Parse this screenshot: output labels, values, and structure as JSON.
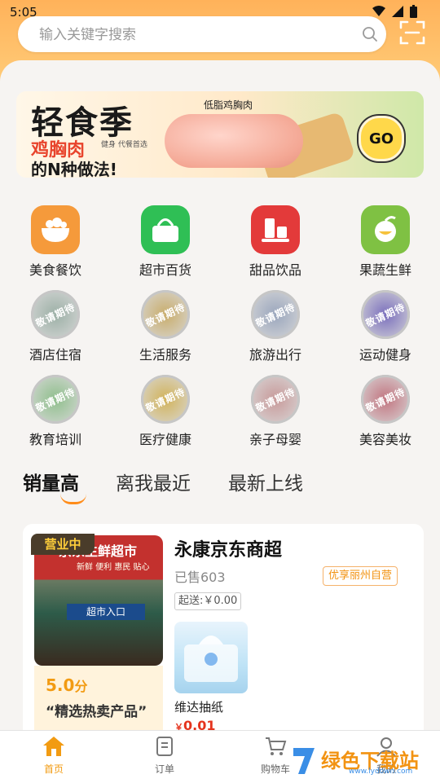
{
  "status_bar": {
    "time": "5:05"
  },
  "search": {
    "placeholder": "输入关键字搜索"
  },
  "banner": {
    "title": "轻食季",
    "line1": "鸡胸肉",
    "line2": "的N种做法!",
    "tag": "健身 代餐首选",
    "label": "低脂鸡胸肉",
    "go": "GO"
  },
  "categories": [
    {
      "label": "美食餐饮",
      "icon": "food-bowl-icon",
      "color": "#f59a3b"
    },
    {
      "label": "超市百货",
      "icon": "shopping-basket-icon",
      "color": "#2fbf55"
    },
    {
      "label": "甜品饮品",
      "icon": "dessert-drink-icon",
      "color": "#e33a3a"
    },
    {
      "label": "果蔬生鲜",
      "icon": "fruit-icon",
      "color": "#7fc143"
    },
    {
      "label": "酒店住宿",
      "icon": "coming-soon-icon",
      "color": "#9cb0a6"
    },
    {
      "label": "生活服务",
      "icon": "coming-soon-icon",
      "color": "#c9ad6b"
    },
    {
      "label": "旅游出行",
      "icon": "coming-soon-icon",
      "color": "#9aa6bd"
    },
    {
      "label": "运动健身",
      "icon": "coming-soon-icon",
      "color": "#7a6fbd"
    },
    {
      "label": "教育培训",
      "icon": "coming-soon-icon",
      "color": "#8fbf8c"
    },
    {
      "label": "医疗健康",
      "icon": "coming-soon-icon",
      "color": "#d2b35a"
    },
    {
      "label": "亲子母婴",
      "icon": "coming-soon-icon",
      "color": "#c89a9a"
    },
    {
      "label": "美容美妆",
      "icon": "coming-soon-icon",
      "color": "#c27580"
    }
  ],
  "coming_soon_text": "敬请期待",
  "tabs": [
    "销量高",
    "离我最近",
    "最新上线"
  ],
  "shop": {
    "badge": "营业中",
    "photo_sign": "京东生鲜超市",
    "photo_sub": "新鲜 便利 惠民 贴心",
    "photo_door": "超市入口",
    "score": "5.0",
    "score_unit": "分",
    "slogan": "“精选热卖产品”",
    "name": "永康京东商超",
    "sold": "已售603",
    "self_operated": "优享丽州自营",
    "delivery": "起送:￥0.00",
    "product": {
      "name": "维达抽纸",
      "currency": "￥",
      "price": "0.01"
    }
  },
  "bottom_nav": [
    {
      "label": "首页",
      "icon": "home-icon"
    },
    {
      "label": "订单",
      "icon": "order-icon"
    },
    {
      "label": "购物车",
      "icon": "cart-icon"
    },
    {
      "label": "我的",
      "icon": "user-icon"
    }
  ],
  "watermark": {
    "text": "绿色下载站",
    "url": "www.lydown.com"
  },
  "colors": {
    "accent": "#f29b12",
    "price": "#e5341e"
  }
}
